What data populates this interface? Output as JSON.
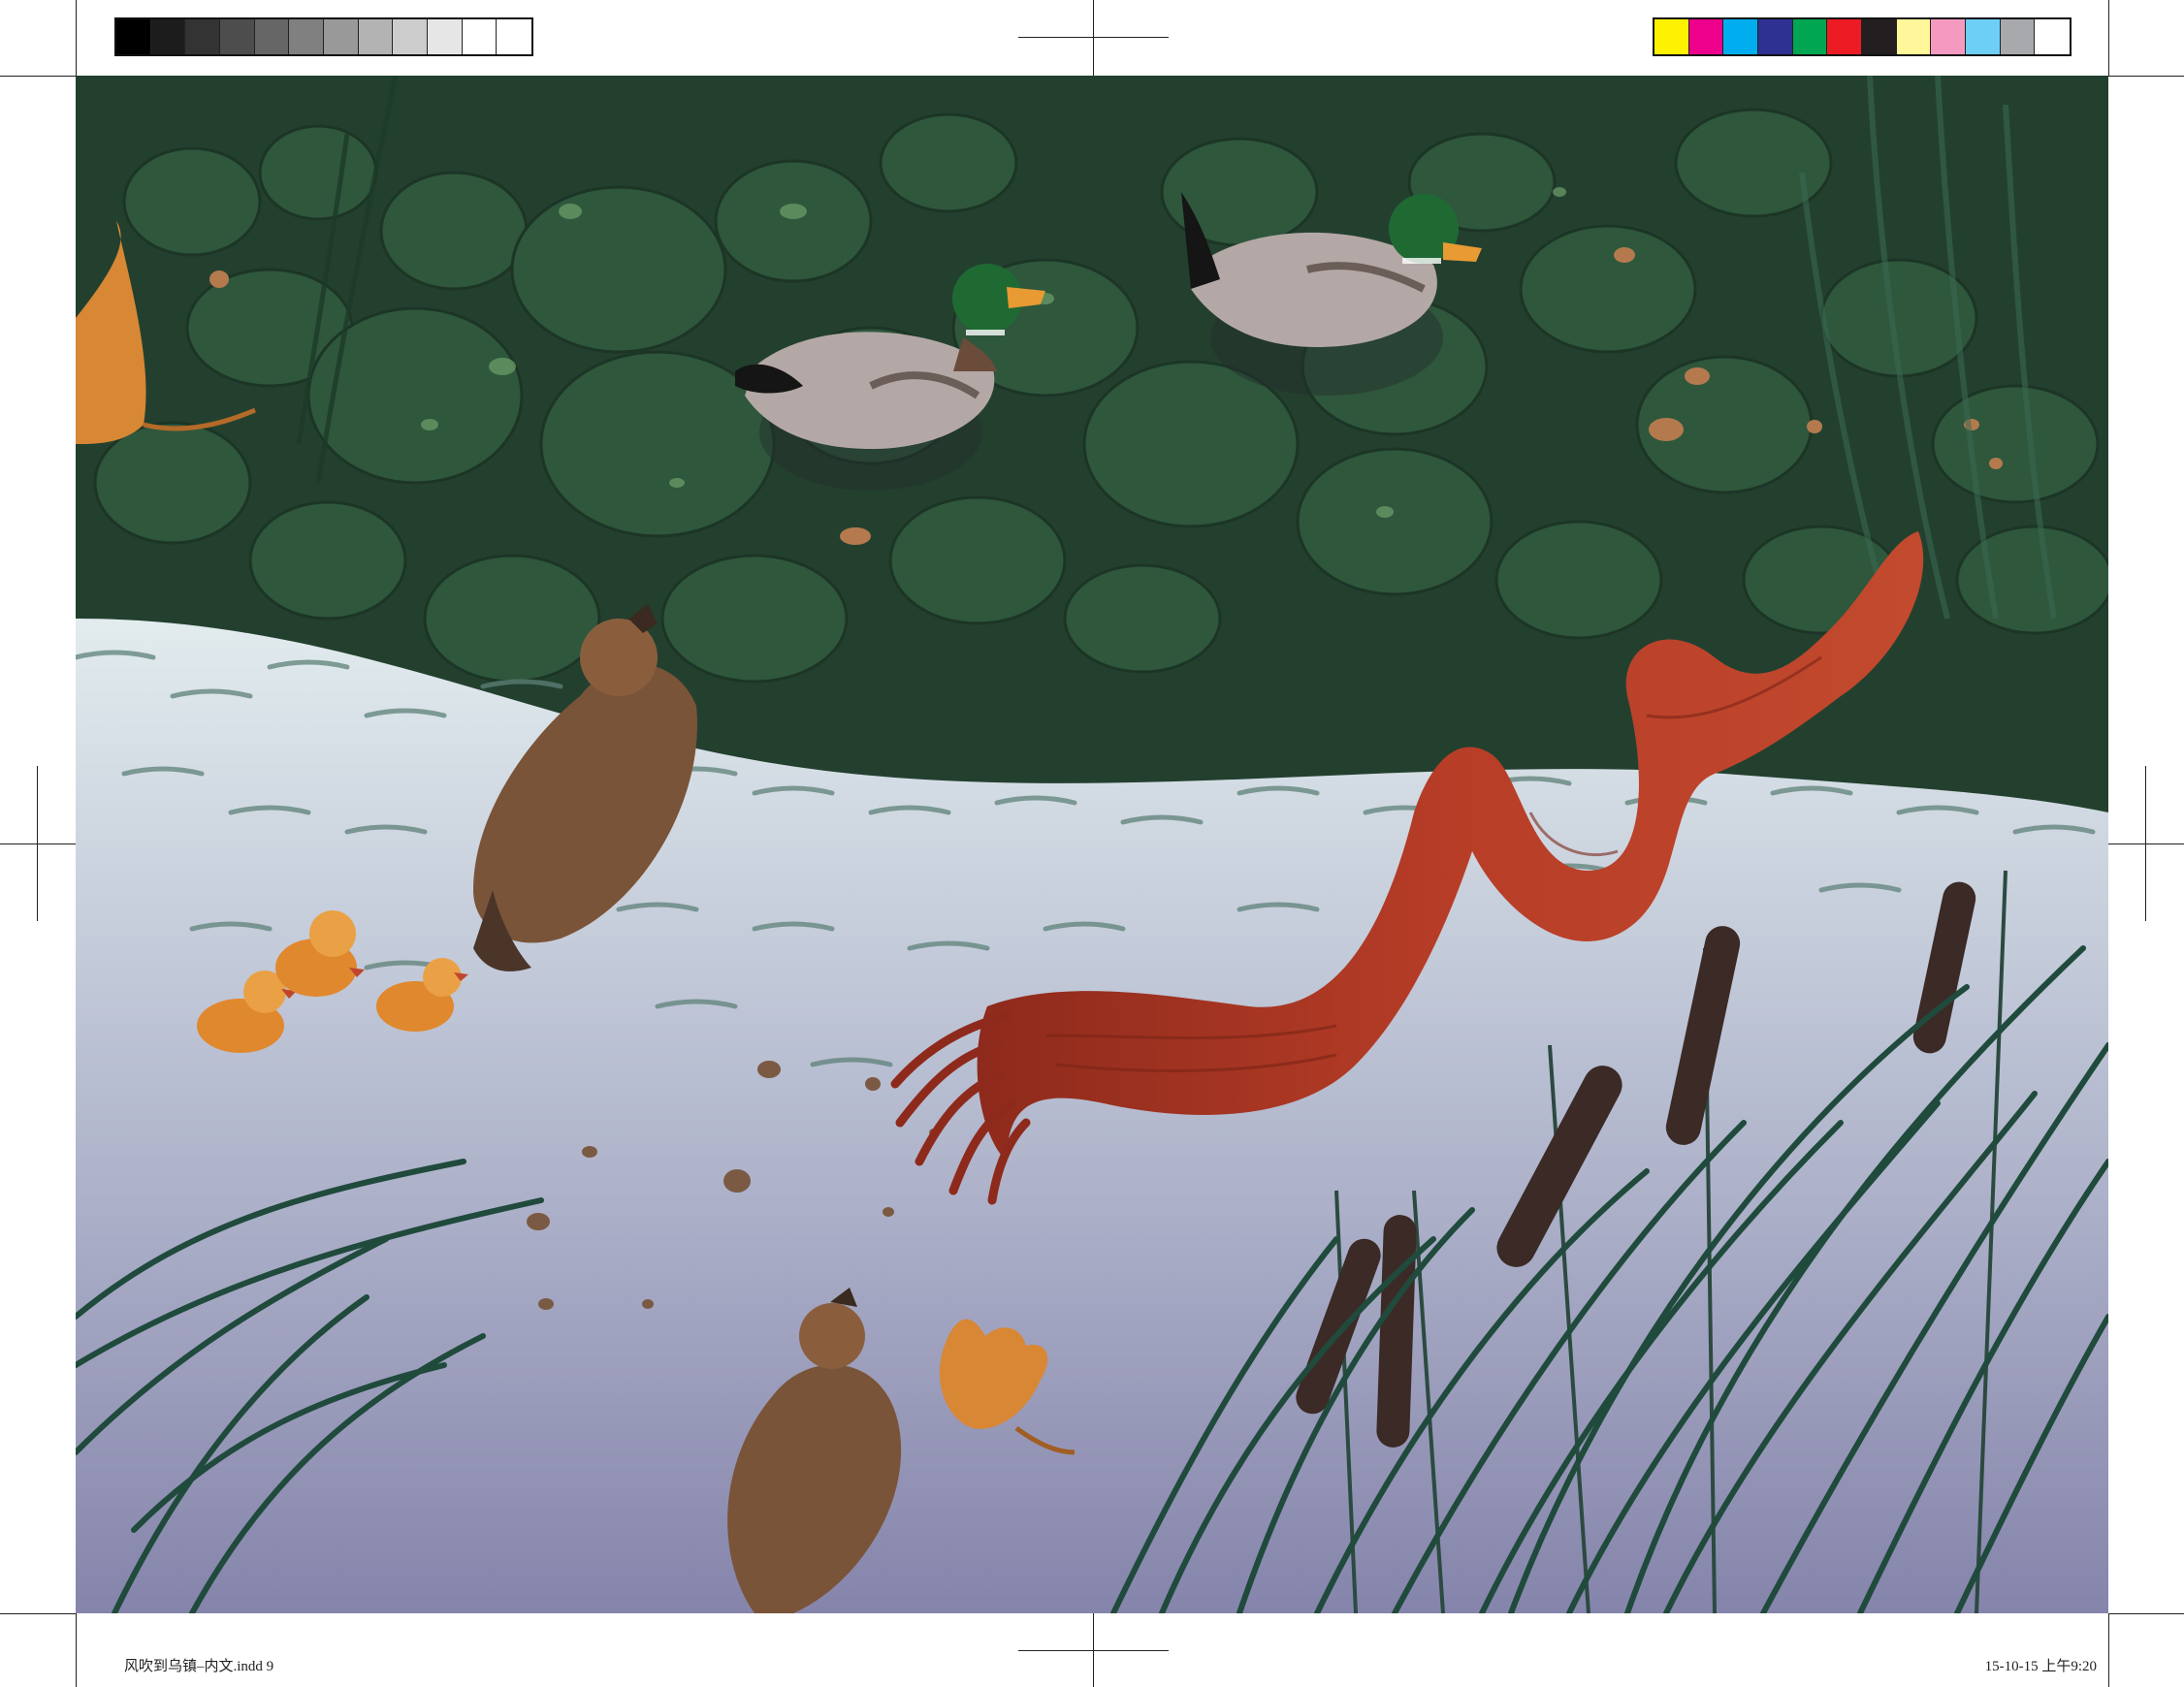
{
  "print_slug": {
    "file_label": "风吹到乌镇–内文.indd 9",
    "timestamp": "15-10-15 上午9:20"
  },
  "registration": {
    "gray_steps": [
      "#000000",
      "#1c1c1c",
      "#333333",
      "#4d4d4d",
      "#666666",
      "#808080",
      "#999999",
      "#b3b3b3",
      "#cccccc",
      "#e6e6e6",
      "#ffffff",
      "#ffffff"
    ],
    "color_swatches": [
      "#fff200",
      "#ec008c",
      "#00aeef",
      "#2e3192",
      "#00a651",
      "#ed1c24",
      "#231f20",
      "#fff799",
      "#f49ac1",
      "#6dcff6",
      "#a7a9ac",
      "#ffffff"
    ]
  },
  "illustration": {
    "palette": {
      "pond_green": "#23402f",
      "stone_green": "#2f5a3e",
      "shallow_water": "#d6e2e6",
      "lavender_water": "#8e8db2",
      "scarf_red": "#b23a26",
      "reed_green": "#1f4a3c",
      "cattail_brown": "#3b2a26",
      "duckling_orange": "#e0882e",
      "leaf_orange": "#d88735",
      "mallard_head": "#1f6a33"
    },
    "elements": [
      "mallard-drake-left",
      "mallard-drake-right",
      "female-duck-center",
      "female-duck-bottom",
      "duckling-1",
      "duckling-2",
      "duckling-3",
      "red-scarf",
      "cattail-reeds",
      "fallen-leaf-left",
      "fallen-leaf-bottom"
    ]
  }
}
